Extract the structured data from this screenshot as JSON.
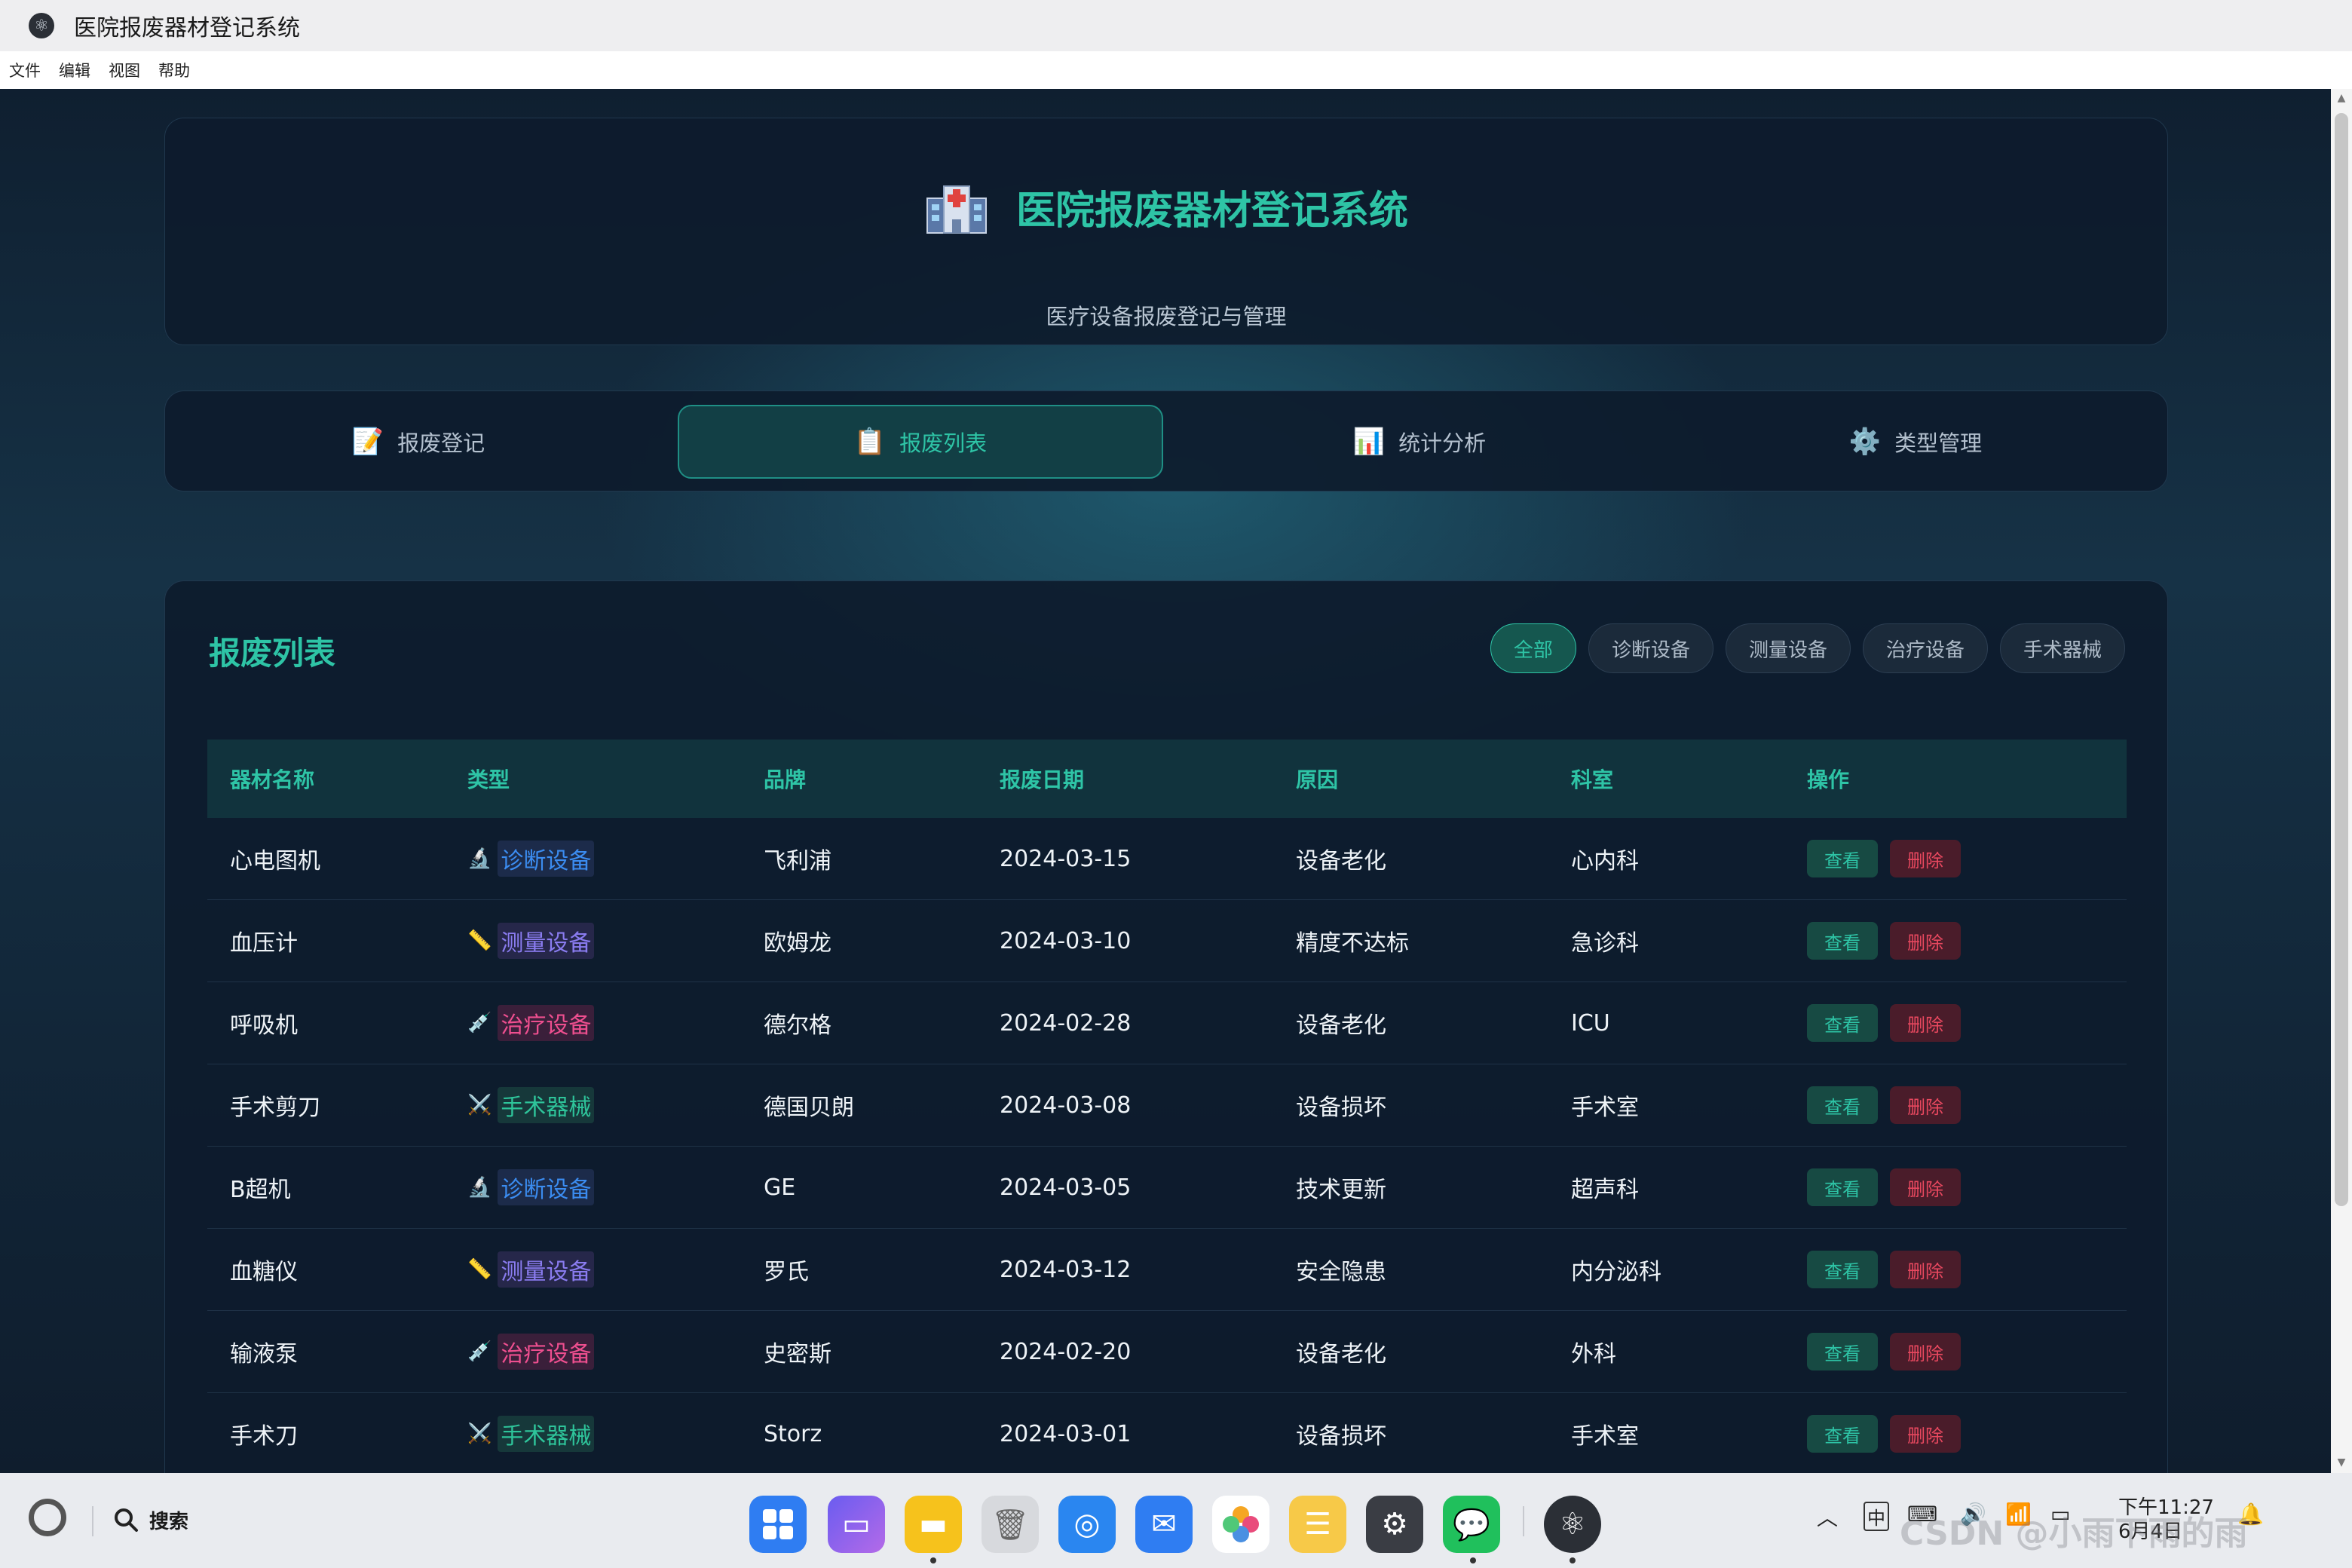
{
  "window": {
    "title": "医院报废器材登记系统",
    "menu": [
      "文件",
      "编辑",
      "视图",
      "帮助"
    ]
  },
  "header": {
    "icon": "hospital-icon",
    "title": "医院报废器材登记系统",
    "subtitle": "医疗设备报废登记与管理"
  },
  "tabs": [
    {
      "icon": "📝",
      "label": "报废登记",
      "active": false
    },
    {
      "icon": "📋",
      "label": "报废列表",
      "active": true
    },
    {
      "icon": "📊",
      "label": "统计分析",
      "active": false
    },
    {
      "icon": "⚙️",
      "label": "类型管理",
      "active": false
    }
  ],
  "list": {
    "title": "报废列表",
    "filters": [
      "全部",
      "诊断设备",
      "测量设备",
      "治疗设备",
      "手术器械"
    ],
    "active_filter": "全部",
    "columns": [
      "器材名称",
      "类型",
      "品牌",
      "报废日期",
      "原因",
      "科室",
      "操作"
    ],
    "view_label": "查看",
    "delete_label": "删除",
    "type_styles": {
      "诊断设备": {
        "glyph": "🔬",
        "color": "#3b8cf0",
        "bg": "#1c2b4a"
      },
      "测量设备": {
        "glyph": "📏",
        "color": "#8a7cf0",
        "bg": "#26274a"
      },
      "治疗设备": {
        "glyph": "💉",
        "color": "#ee4f8f",
        "bg": "#3a1f3a"
      },
      "手术器械": {
        "glyph": "⚔️",
        "color": "#2ec49a",
        "bg": "#16383a"
      }
    },
    "rows": [
      {
        "name": "心电图机",
        "type": "诊断设备",
        "brand": "飞利浦",
        "date": "2024-03-15",
        "reason": "设备老化",
        "dept": "心内科"
      },
      {
        "name": "血压计",
        "type": "测量设备",
        "brand": "欧姆龙",
        "date": "2024-03-10",
        "reason": "精度不达标",
        "dept": "急诊科"
      },
      {
        "name": "呼吸机",
        "type": "治疗设备",
        "brand": "德尔格",
        "date": "2024-02-28",
        "reason": "设备老化",
        "dept": "ICU"
      },
      {
        "name": "手术剪刀",
        "type": "手术器械",
        "brand": "德国贝朗",
        "date": "2024-03-08",
        "reason": "设备损坏",
        "dept": "手术室"
      },
      {
        "name": "B超机",
        "type": "诊断设备",
        "brand": "GE",
        "date": "2024-03-05",
        "reason": "技术更新",
        "dept": "超声科"
      },
      {
        "name": "血糖仪",
        "type": "测量设备",
        "brand": "罗氏",
        "date": "2024-03-12",
        "reason": "安全隐患",
        "dept": "内分泌科"
      },
      {
        "name": "输液泵",
        "type": "治疗设备",
        "brand": "史密斯",
        "date": "2024-02-20",
        "reason": "设备老化",
        "dept": "外科"
      },
      {
        "name": "手术刀",
        "type": "手术器械",
        "brand": "Storz",
        "date": "2024-03-01",
        "reason": "设备损坏",
        "dept": "手术室"
      }
    ]
  },
  "taskbar": {
    "search_label": "搜索",
    "dock": [
      "windows-start-icon",
      "multitask-icon",
      "files-folder-icon",
      "trash-icon",
      "browser-icon",
      "mail-icon",
      "photos-icon",
      "notes-icon",
      "settings-icon",
      "wechat-icon",
      "electron-app-icon"
    ],
    "ime": "中",
    "time": "下午11:27",
    "date": "6月4日",
    "watermark": "CSDN @小雨下雨的雨"
  }
}
